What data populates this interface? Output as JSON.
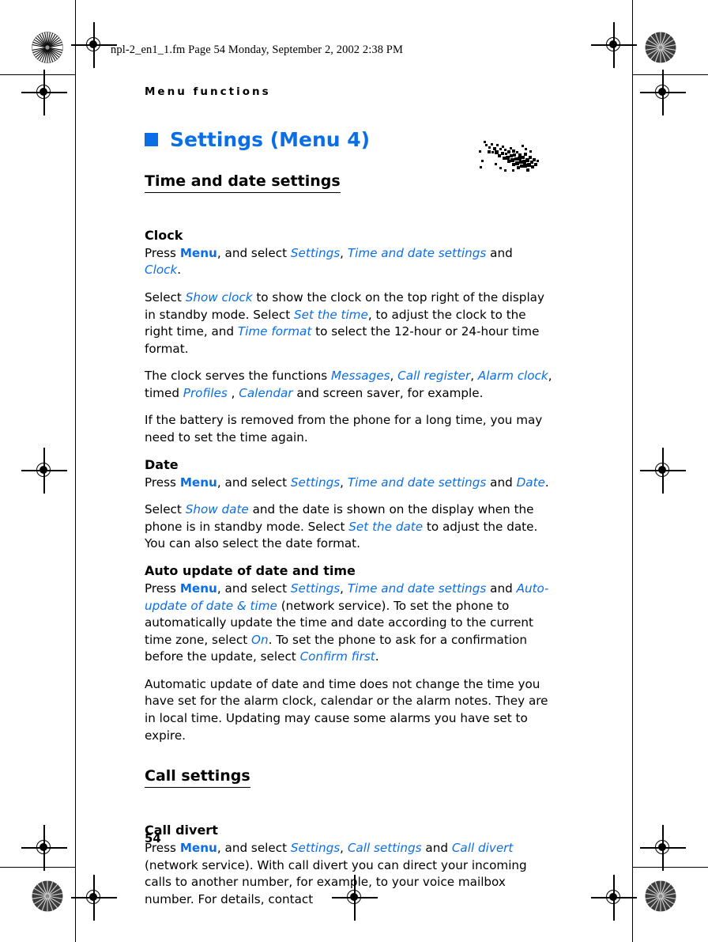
{
  "document": {
    "file_header": "npl-2_en1_1.fm  Page 54  Monday, September 2, 2002  2:38 PM",
    "running_head": "Menu functions",
    "page_number": "54",
    "accent_color": "#0A6EE8"
  },
  "chapter": {
    "title": "Settings (Menu 4)"
  },
  "sections": [
    {
      "heading": "Time and date settings",
      "subsections": [
        {
          "heading": "Clock",
          "paragraphs": [
            {
              "runs": [
                {
                  "t": "Press ",
                  "s": "plain"
                },
                {
                  "t": "Menu",
                  "s": "kw"
                },
                {
                  "t": ", and select ",
                  "s": "plain"
                },
                {
                  "t": "Settings",
                  "s": "mi"
                },
                {
                  "t": ", ",
                  "s": "plain"
                },
                {
                  "t": "Time and date settings",
                  "s": "mi"
                },
                {
                  "t": " and ",
                  "s": "plain"
                },
                {
                  "t": "Clock",
                  "s": "mi"
                },
                {
                  "t": ".",
                  "s": "plain"
                }
              ]
            },
            {
              "runs": [
                {
                  "t": "Select ",
                  "s": "plain"
                },
                {
                  "t": "Show clock",
                  "s": "mi"
                },
                {
                  "t": " to show the clock on the top right of the display in standby mode. Select ",
                  "s": "plain"
                },
                {
                  "t": "Set the time",
                  "s": "mi"
                },
                {
                  "t": ", to adjust the clock to the right time, and ",
                  "s": "plain"
                },
                {
                  "t": "Time format",
                  "s": "mi"
                },
                {
                  "t": " to select the 12-hour or 24-hour time format.",
                  "s": "plain"
                }
              ]
            },
            {
              "runs": [
                {
                  "t": "The clock serves the functions ",
                  "s": "plain"
                },
                {
                  "t": "Messages",
                  "s": "mi"
                },
                {
                  "t": ", ",
                  "s": "plain"
                },
                {
                  "t": "Call register",
                  "s": "mi"
                },
                {
                  "t": ", ",
                  "s": "plain"
                },
                {
                  "t": "Alarm clock",
                  "s": "mi"
                },
                {
                  "t": ", timed ",
                  "s": "plain"
                },
                {
                  "t": "Profiles",
                  "s": "mi"
                },
                {
                  "t": " , ",
                  "s": "plain"
                },
                {
                  "t": "Calendar",
                  "s": "mi"
                },
                {
                  "t": " and screen saver, for example.",
                  "s": "plain"
                }
              ]
            },
            {
              "runs": [
                {
                  "t": "If the battery is removed from the phone for a long time, you may need to set the time again.",
                  "s": "plain"
                }
              ]
            }
          ]
        },
        {
          "heading": "Date",
          "paragraphs": [
            {
              "runs": [
                {
                  "t": "Press ",
                  "s": "plain"
                },
                {
                  "t": "Menu",
                  "s": "kw"
                },
                {
                  "t": ", and select ",
                  "s": "plain"
                },
                {
                  "t": "Settings",
                  "s": "mi"
                },
                {
                  "t": ", ",
                  "s": "plain"
                },
                {
                  "t": "Time and date settings",
                  "s": "mi"
                },
                {
                  "t": " and ",
                  "s": "plain"
                },
                {
                  "t": "Date",
                  "s": "mi"
                },
                {
                  "t": ".",
                  "s": "plain"
                }
              ]
            },
            {
              "runs": [
                {
                  "t": "Select ",
                  "s": "plain"
                },
                {
                  "t": "Show date",
                  "s": "mi"
                },
                {
                  "t": " and the date is shown on the display when the phone is in standby mode. Select ",
                  "s": "plain"
                },
                {
                  "t": "Set the date",
                  "s": "mi"
                },
                {
                  "t": " to adjust the date. You can also select the date format.",
                  "s": "plain"
                }
              ]
            }
          ]
        },
        {
          "heading": "Auto update of date and time",
          "paragraphs": [
            {
              "runs": [
                {
                  "t": "Press ",
                  "s": "plain"
                },
                {
                  "t": "Menu",
                  "s": "kw"
                },
                {
                  "t": ", and select ",
                  "s": "plain"
                },
                {
                  "t": "Settings",
                  "s": "mi"
                },
                {
                  "t": ", ",
                  "s": "plain"
                },
                {
                  "t": "Time and date settings",
                  "s": "mi"
                },
                {
                  "t": " and ",
                  "s": "plain"
                },
                {
                  "t": "Auto-update of date & time",
                  "s": "mi"
                },
                {
                  "t": " (network service). To set the phone to automatically update the time and date according to the current time zone, select ",
                  "s": "plain"
                },
                {
                  "t": "On",
                  "s": "mi"
                },
                {
                  "t": ". To set the phone to ask for a confirmation before the update, select ",
                  "s": "plain"
                },
                {
                  "t": "Confirm first",
                  "s": "mi"
                },
                {
                  "t": ".",
                  "s": "plain"
                }
              ]
            },
            {
              "runs": [
                {
                  "t": "Automatic update of date and time does not change the time you have set for the alarm clock, calendar or the alarm notes. They are in local time. Updating may cause some alarms you have set to expire.",
                  "s": "plain"
                }
              ]
            }
          ]
        }
      ]
    },
    {
      "heading": "Call settings",
      "subsections": [
        {
          "heading": "Call divert",
          "paragraphs": [
            {
              "runs": [
                {
                  "t": "Press ",
                  "s": "plain"
                },
                {
                  "t": "Menu",
                  "s": "kw"
                },
                {
                  "t": ", and select ",
                  "s": "plain"
                },
                {
                  "t": "Settings",
                  "s": "mi"
                },
                {
                  "t": ", ",
                  "s": "plain"
                },
                {
                  "t": "Call settings",
                  "s": "mi"
                },
                {
                  "t": " and ",
                  "s": "plain"
                },
                {
                  "t": "Call divert",
                  "s": "mi"
                },
                {
                  "t": " (network service). With call divert you can direct your incoming calls to another number, for example, to your voice mailbox number. For details, contact",
                  "s": "plain"
                }
              ]
            }
          ]
        }
      ]
    }
  ],
  "prepress": {
    "registration_mark_label": "registration-target",
    "star_target_label": "star-density-target",
    "trim_line_label": "trim-line"
  }
}
